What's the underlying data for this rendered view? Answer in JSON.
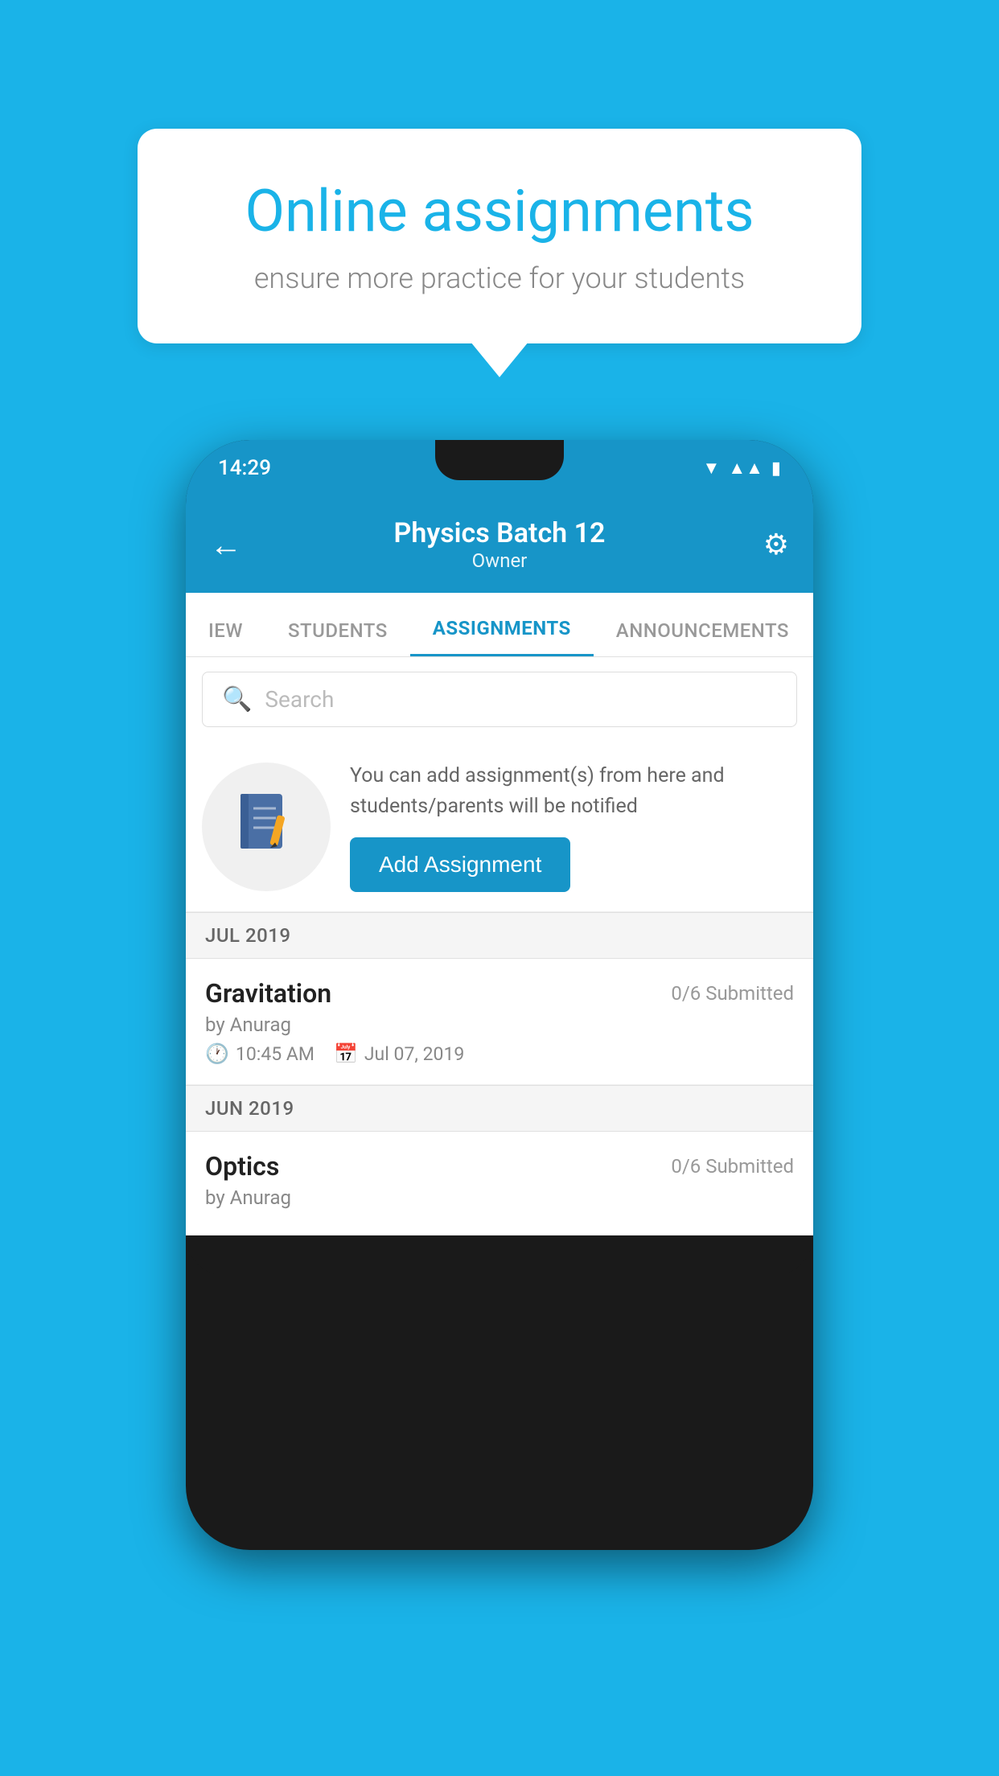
{
  "background_color": "#1ab3e8",
  "speech_bubble": {
    "title": "Online assignments",
    "subtitle": "ensure more practice for your students"
  },
  "phone": {
    "status_bar": {
      "time": "14:29"
    },
    "header": {
      "title": "Physics Batch 12",
      "subtitle": "Owner",
      "back_label": "←",
      "settings_label": "⚙"
    },
    "tabs": [
      {
        "label": "IEW",
        "active": false
      },
      {
        "label": "STUDENTS",
        "active": false
      },
      {
        "label": "ASSIGNMENTS",
        "active": true
      },
      {
        "label": "ANNOUNCEMENTS",
        "active": false
      }
    ],
    "search": {
      "placeholder": "Search"
    },
    "promo": {
      "description": "You can add assignment(s) from here and students/parents will be notified",
      "button_label": "Add Assignment"
    },
    "sections": [
      {
        "month": "JUL 2019",
        "assignments": [
          {
            "title": "Gravitation",
            "submitted": "0/6 Submitted",
            "author": "by Anurag",
            "time": "10:45 AM",
            "date": "Jul 07, 2019"
          }
        ]
      },
      {
        "month": "JUN 2019",
        "assignments": [
          {
            "title": "Optics",
            "submitted": "0/6 Submitted",
            "author": "by Anurag",
            "time": "",
            "date": ""
          }
        ]
      }
    ]
  }
}
